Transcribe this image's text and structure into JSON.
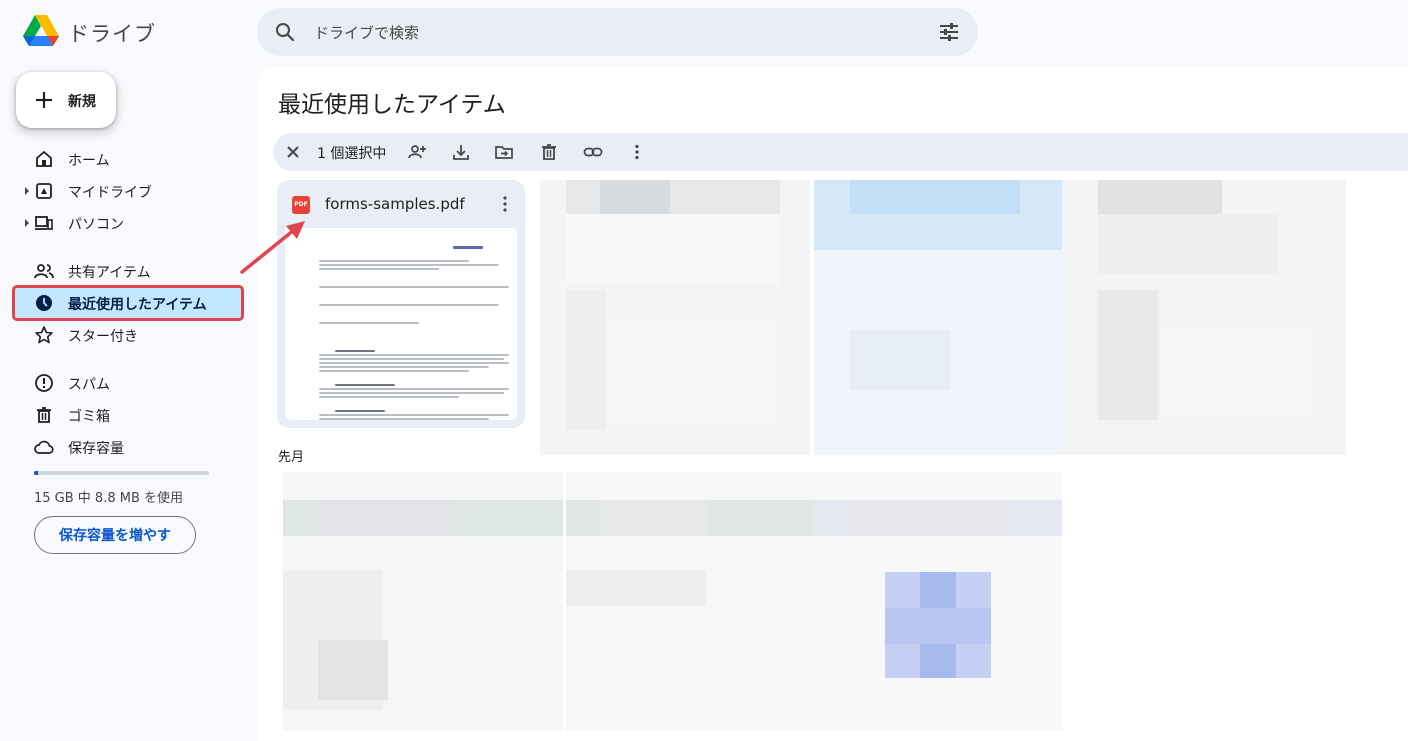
{
  "app": {
    "title": "ドライブ"
  },
  "search": {
    "placeholder": "ドライブで検索"
  },
  "sidebar": {
    "new_label": "新規",
    "items": [
      {
        "label": "ホーム",
        "icon": "home-icon"
      },
      {
        "label": "マイドライブ",
        "icon": "my-drive-icon"
      },
      {
        "label": "パソコン",
        "icon": "computers-icon"
      },
      {
        "label": "共有アイテム",
        "icon": "shared-icon"
      },
      {
        "label": "最近使用したアイテム",
        "icon": "recent-clock-icon",
        "active": true
      },
      {
        "label": "スター付き",
        "icon": "star-icon"
      },
      {
        "label": "スパム",
        "icon": "spam-icon"
      },
      {
        "label": "ゴミ箱",
        "icon": "trash-icon"
      },
      {
        "label": "保存容量",
        "icon": "cloud-icon"
      }
    ],
    "storage": {
      "used_text": "15 GB 中 8.8 MB を使用",
      "used_fraction": 0.01,
      "upgrade_label": "保存容量を増やす"
    }
  },
  "main": {
    "title": "最近使用したアイテム",
    "selection": {
      "count_label": "1 個選択中"
    },
    "files": [
      {
        "name": "forms-samples.pdf",
        "type_badge": "PDF"
      }
    ],
    "sections": {
      "last_month": "先月"
    }
  },
  "colors": {
    "accent": "#0b57d0",
    "active_bg": "#c2e7ff",
    "highlight": "#e0454d",
    "pdf_red": "#ea4335"
  }
}
